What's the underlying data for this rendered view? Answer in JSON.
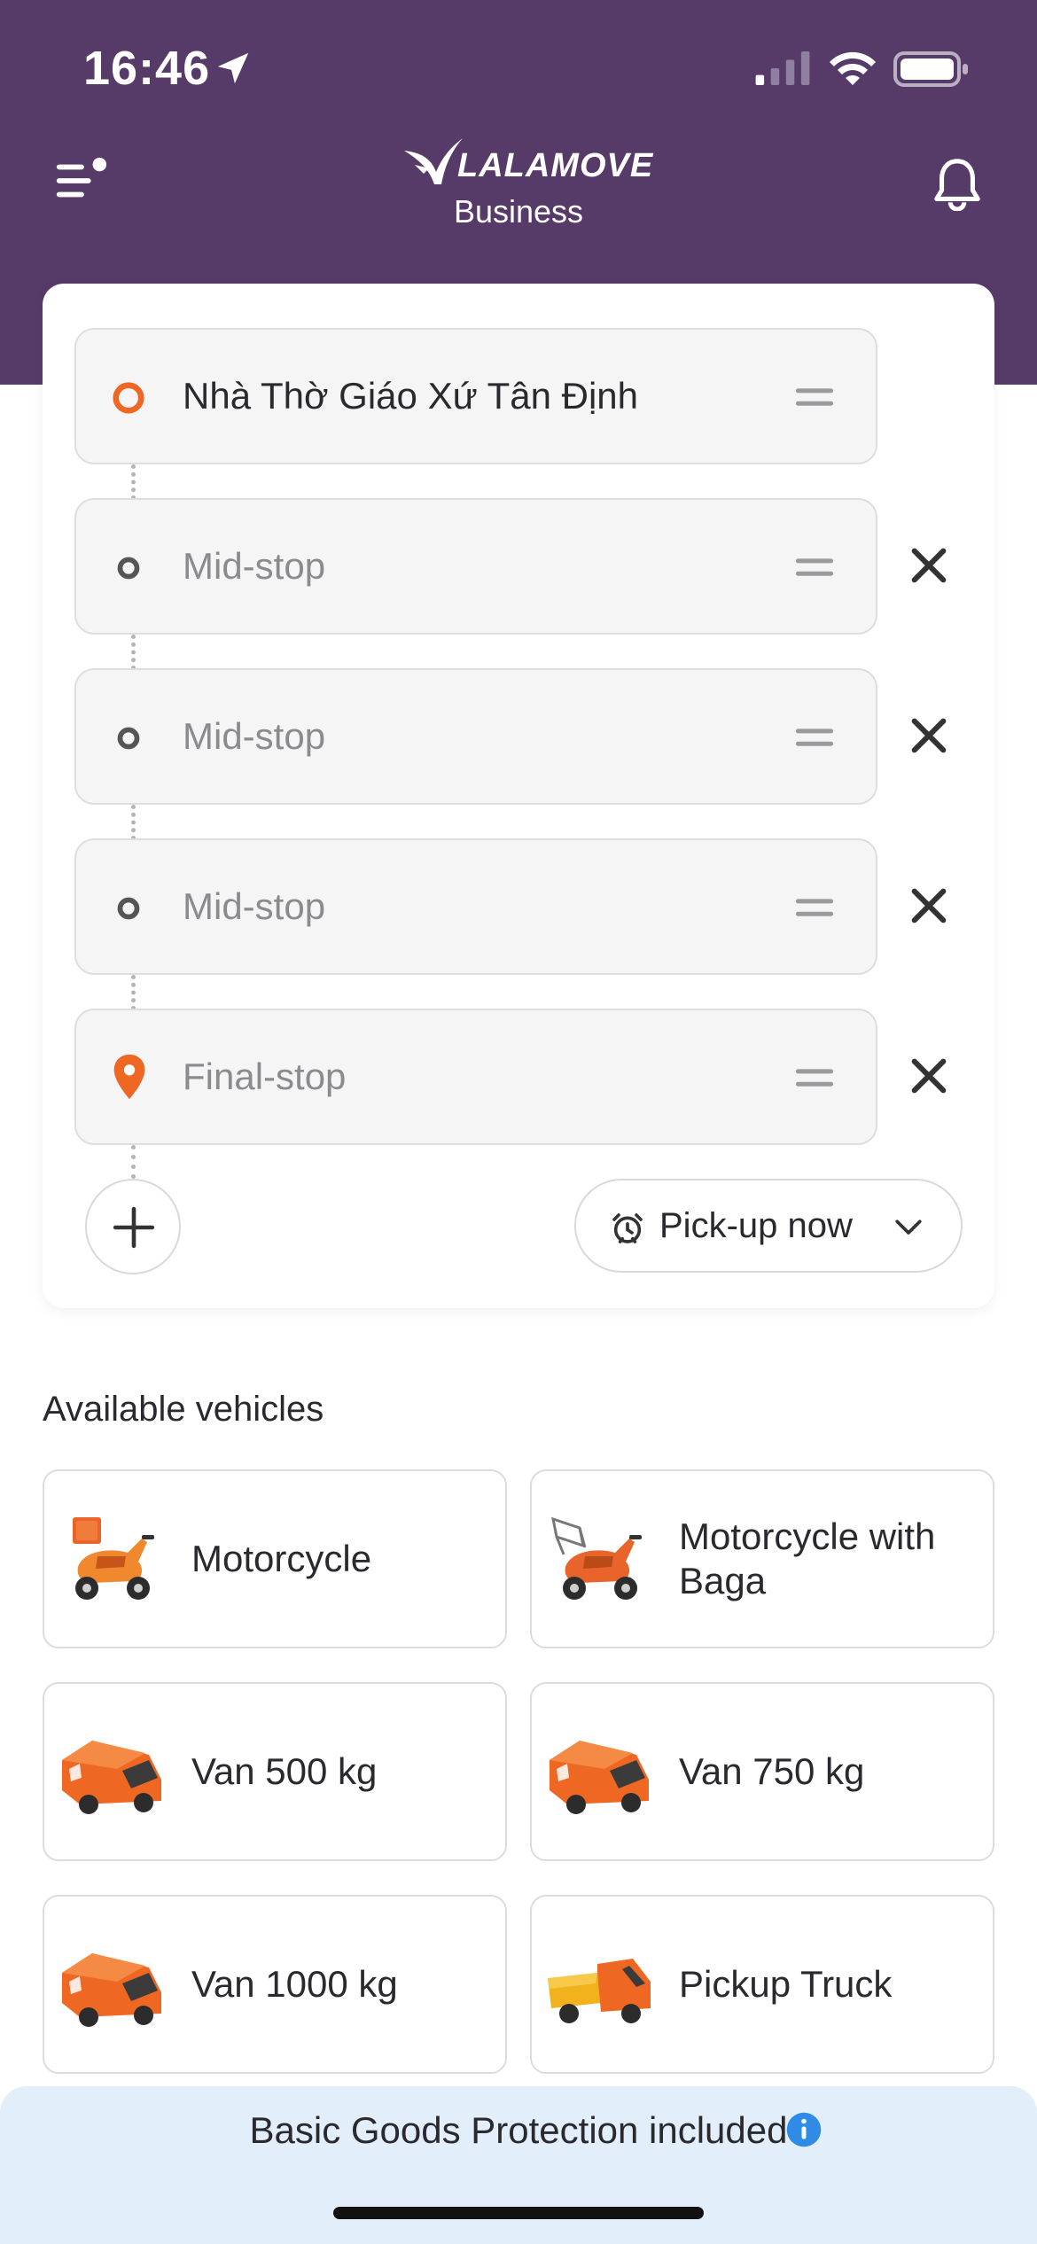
{
  "status_bar": {
    "time": "16:46"
  },
  "header": {
    "brand": "LALAMOVE",
    "subtitle": "Business",
    "brand_color": "#563b68"
  },
  "route": {
    "stops": [
      {
        "label": "Nhà Thờ Giáo Xứ Tân Định",
        "type": "pickup",
        "filled": true
      },
      {
        "label": "Mid-stop",
        "type": "mid",
        "filled": false
      },
      {
        "label": "Mid-stop",
        "type": "mid",
        "filled": false
      },
      {
        "label": "Mid-stop",
        "type": "mid",
        "filled": false
      },
      {
        "label": "Final-stop",
        "type": "final",
        "filled": false
      }
    ],
    "pickup_time_label": "Pick-up now",
    "accent_color": "#ee6723"
  },
  "vehicles": {
    "title": "Available vehicles",
    "items": [
      {
        "name": "Motorcycle",
        "icon": "motorcycle-icon"
      },
      {
        "name": "Motorcycle with Baga",
        "icon": "motorcycle-baga-icon"
      },
      {
        "name": "Van 500 kg",
        "icon": "van-icon"
      },
      {
        "name": "Van 750 kg",
        "icon": "van-icon"
      },
      {
        "name": "Van 1000 kg",
        "icon": "van-icon"
      },
      {
        "name": "Pickup Truck",
        "icon": "pickup-truck-icon"
      }
    ]
  },
  "footer": {
    "protection_text": "Basic Goods Protection included",
    "info_color": "#2f8be6"
  }
}
